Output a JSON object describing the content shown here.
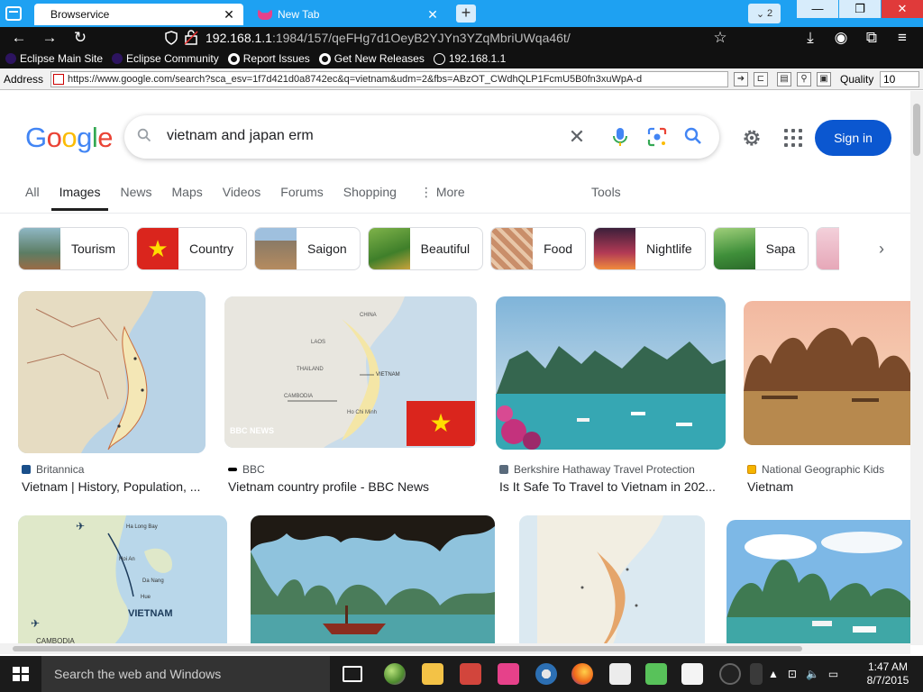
{
  "browser": {
    "tabs": [
      {
        "title": "Browservice",
        "active": true
      },
      {
        "title": "New Tab",
        "active": false
      }
    ],
    "new_tab_label": "+",
    "tab_count": "2",
    "window_controls": {
      "minimize": "—",
      "maximize": "❐",
      "close": "✕"
    },
    "url": {
      "host": "192.168.1.1",
      "rest": ":1984/157/qeFHg7d1OeyB2YJYn3YZqMbriUWqa46t/"
    },
    "bookmarks": [
      {
        "label": "Eclipse Main Site",
        "icon": "eclipse-icon"
      },
      {
        "label": "Eclipse Community",
        "icon": "eclipse-icon"
      },
      {
        "label": "Report Issues",
        "icon": "github-icon"
      },
      {
        "label": "Get New Releases",
        "icon": "github-icon"
      },
      {
        "label": "192.168.1.1",
        "icon": "globe-icon"
      }
    ]
  },
  "browservice_bar": {
    "address_label": "Address",
    "address_value": "https://www.google.com/search?sca_esv=1f7d421d0a8742ec&q=vietnam&udm=2&fbs=ABzOT_CWdhQLP1FcmU5B0fn3xuWpA-d",
    "quality_label": "Quality",
    "quality_value": "10"
  },
  "google": {
    "logo": [
      "G",
      "o",
      "o",
      "g",
      "l",
      "e"
    ],
    "logo_colors": [
      "#4285F4",
      "#EA4335",
      "#FBBC05",
      "#4285F4",
      "#34A853",
      "#EA4335"
    ],
    "query": "vietnam and japan erm",
    "sign_in": "Sign in",
    "tabs": [
      "All",
      "Images",
      "News",
      "Maps",
      "Videos",
      "Forums",
      "Shopping",
      "More"
    ],
    "active_tab": "Images",
    "tools": "Tools",
    "chips": [
      "Tourism",
      "Country",
      "Saigon",
      "Beautiful",
      "Food",
      "Nightlife",
      "Sapa"
    ],
    "results": [
      {
        "source": "Britannica",
        "title": "Vietnam | History, Population, ..."
      },
      {
        "source": "BBC",
        "title": "Vietnam country profile - BBC News"
      },
      {
        "source": "Berkshire Hathaway Travel Protection",
        "title": "Is It Safe To Travel to Vietnam in 202..."
      },
      {
        "source": "National Geographic Kids",
        "title": "Vietnam"
      }
    ],
    "map_labels": {
      "bbc": [
        "CHINA",
        "LAOS",
        "THAILAND",
        "VIETNAM",
        "CAMBODIA",
        "Ho Chi Minh",
        "BBC NEWS"
      ],
      "route": [
        "Ha Long Bay",
        "Hoi An",
        "Da Nang",
        "Hue",
        "VIETNAM",
        "CAMBODIA"
      ]
    }
  },
  "taskbar": {
    "search_placeholder": "Search the web and Windows",
    "time": "1:47 AM",
    "date": "8/7/2015"
  }
}
